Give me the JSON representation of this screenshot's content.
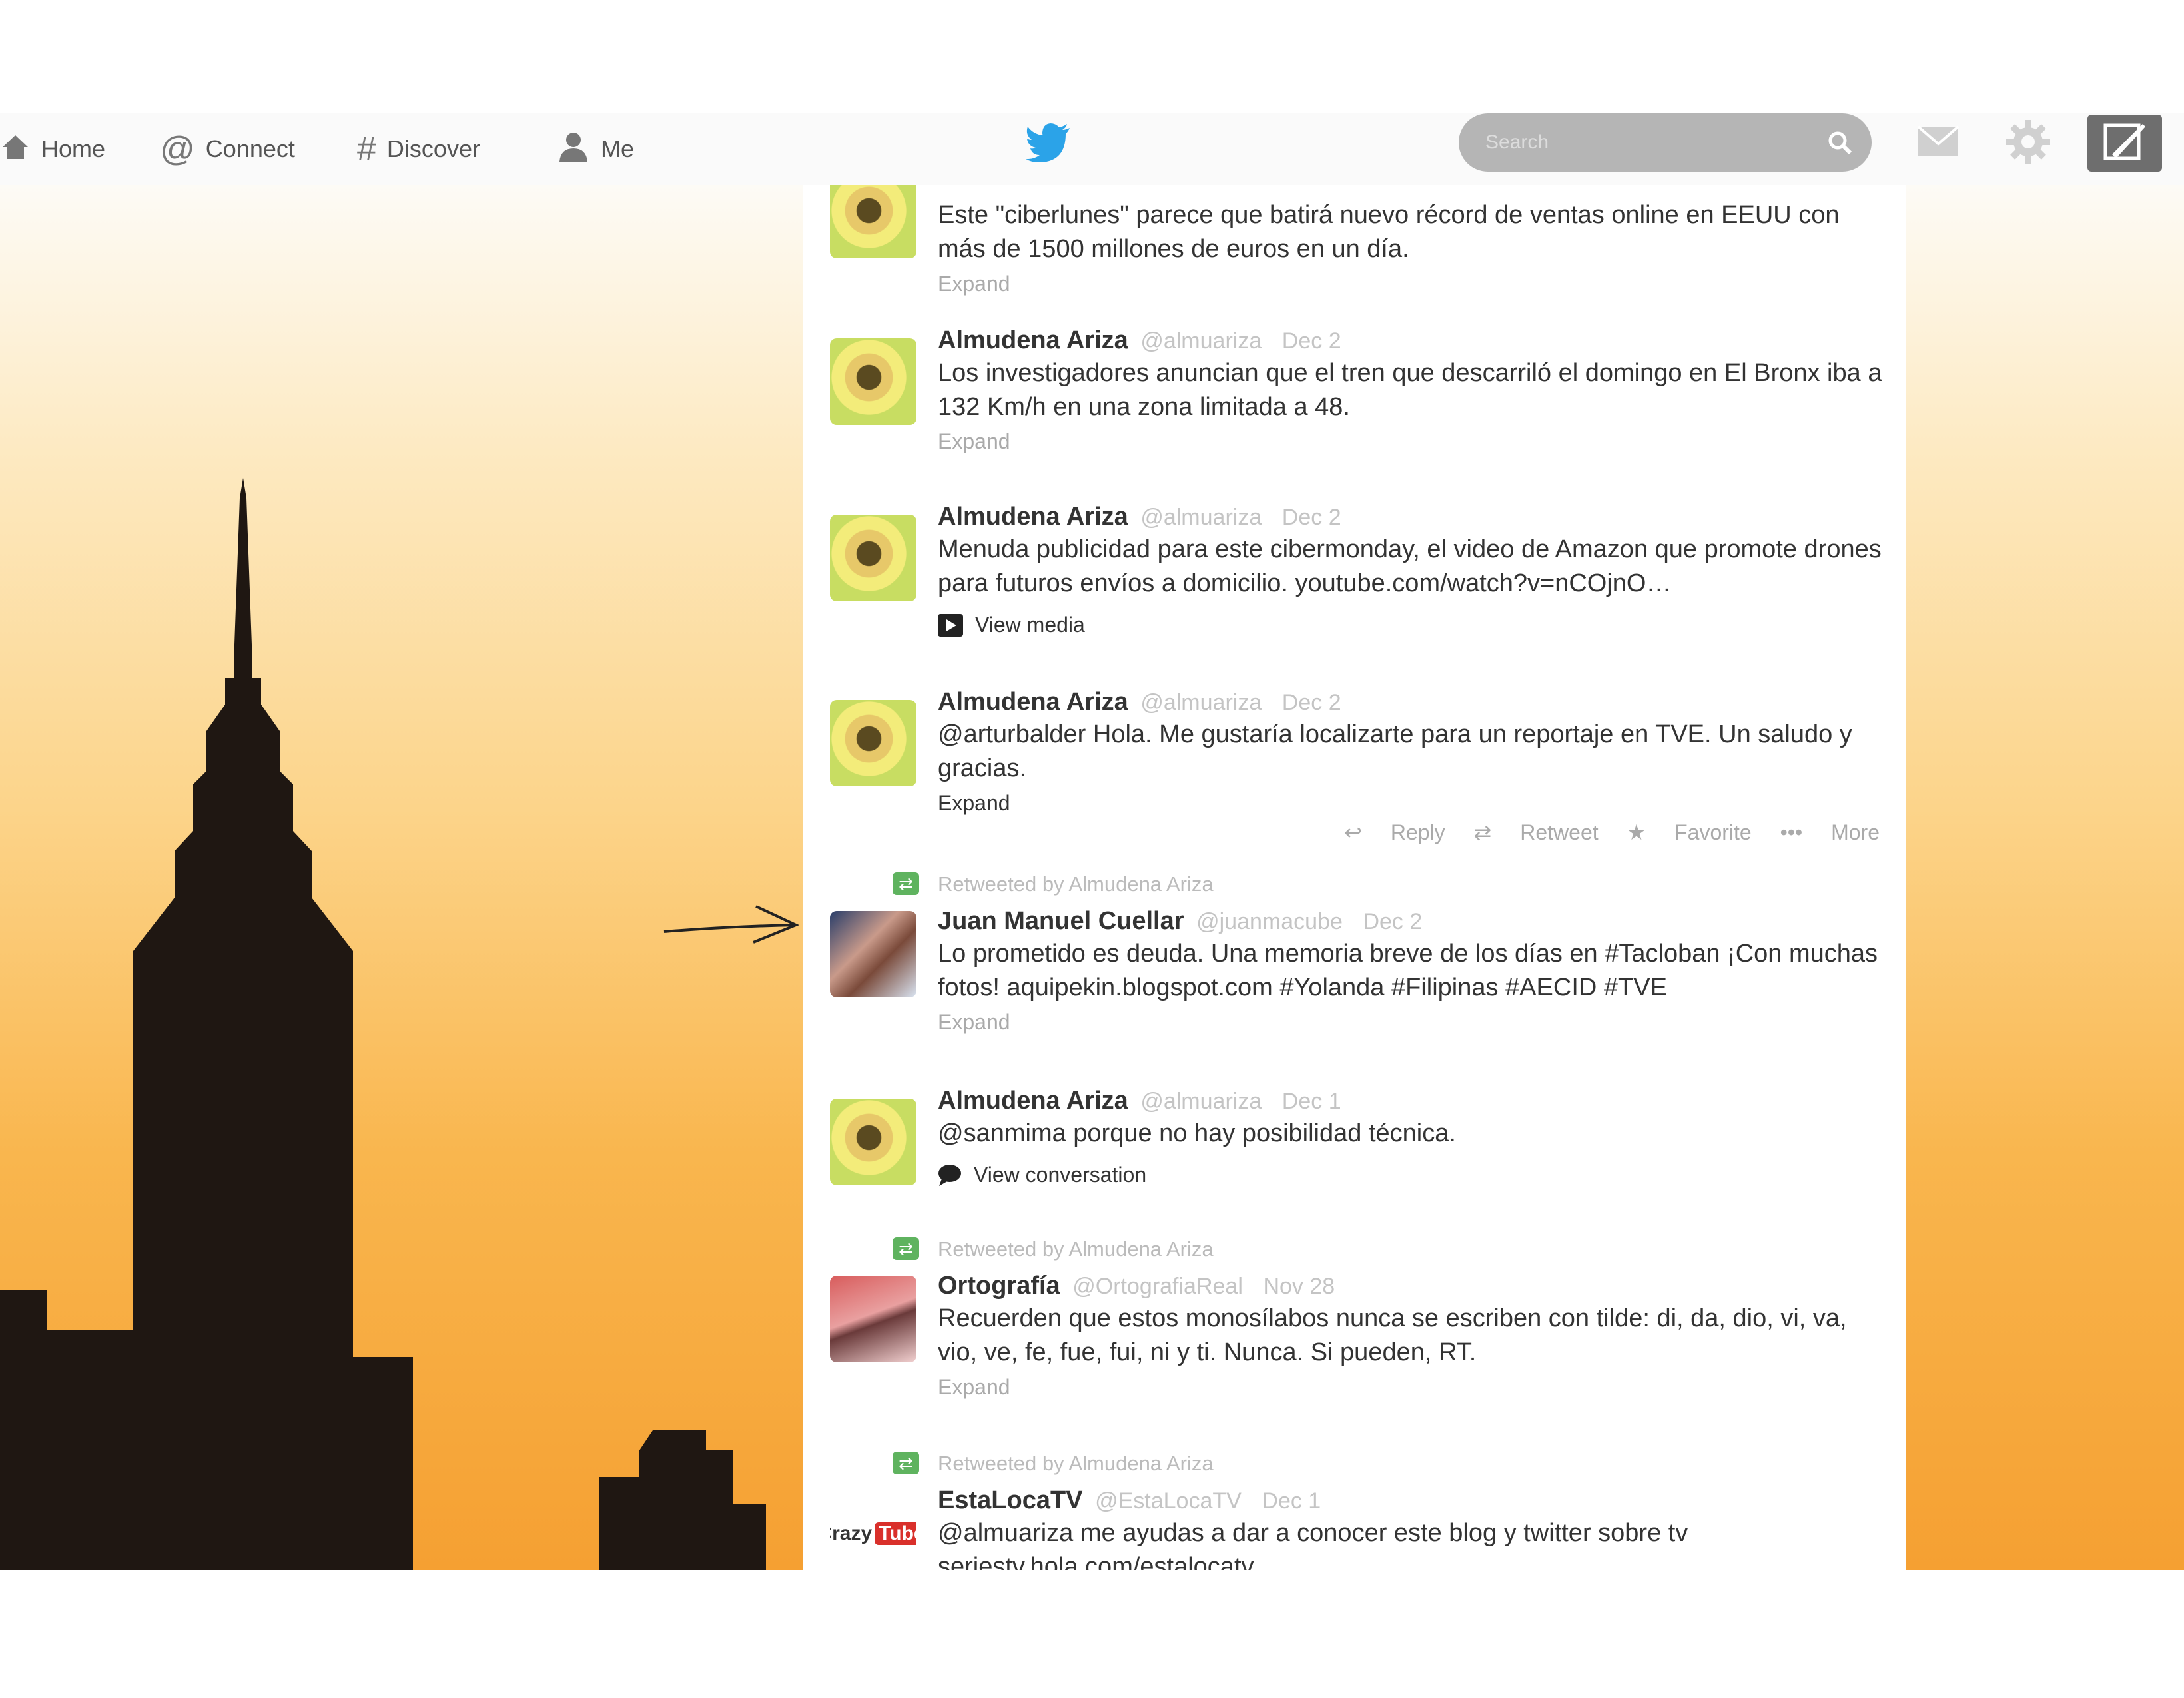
{
  "nav": {
    "home": "Home",
    "connect": "Connect",
    "discover": "Discover",
    "me": "Me"
  },
  "search": {
    "placeholder": "Search"
  },
  "icons": {
    "home": "home-icon",
    "connect": "at-sign-icon",
    "discover": "hashtag-icon",
    "me": "person-icon",
    "logo": "twitter-bird-icon",
    "search": "magnifier-icon",
    "messages": "envelope-icon",
    "settings": "gear-icon",
    "compose": "compose-quill-icon"
  },
  "colors": {
    "twitter_blue": "#2ba3e8",
    "retweet_green": "#5fb35f",
    "background_top": "#fdfbf6",
    "background_bottom": "#f5a032"
  },
  "tweets": [
    {
      "name": "",
      "handle": "",
      "time": "",
      "text": "Este \"ciberlunes\" parece que batirá nuevo récord de ventas online en EEUU con más de 1500 millones de euros en un día.",
      "footer": "Expand"
    },
    {
      "name": "Almudena Ariza",
      "handle": "@almuariza",
      "time": "Dec 2",
      "text": "Los investigadores anuncian que el tren que descarriló el domingo en El Bronx iba a 132 Km/h en una zona limitada a 48.",
      "footer": "Expand"
    },
    {
      "name": "Almudena Ariza",
      "handle": "@almuariza",
      "time": "Dec 2",
      "text": "Menuda publicidad para este cibermonday, el video de Amazon que promote drones para futuros envíos a domicilio. youtube.com/watch?v=nCOjnO…",
      "footer": "View media"
    },
    {
      "name": "Almudena Ariza",
      "handle": "@almuariza",
      "time": "Dec 2",
      "text": "@arturbalder Hola. Me gustaría localizarte para un reportaje en TVE. Un saludo y gracias.",
      "footer": "Expand",
      "actions": {
        "reply": "Reply",
        "retweet": "Retweet",
        "favorite": "Favorite",
        "more": "More"
      }
    },
    {
      "retweeted_by": "Retweeted by Almudena Ariza",
      "name": "Juan Manuel Cuellar",
      "handle": "@juanmacube",
      "time": "Dec 2",
      "text": "Lo prometido es deuda. Una memoria breve de los días en #Tacloban ¡Con muchas fotos! aquipekin.blogspot.com #Yolanda #Filipinas #AECID #TVE",
      "footer": "Expand"
    },
    {
      "name": "Almudena Ariza",
      "handle": "@almuariza",
      "time": "Dec 1",
      "text": "@sanmima porque no hay posibilidad técnica.",
      "footer": "View conversation"
    },
    {
      "retweeted_by": "Retweeted by Almudena Ariza",
      "name": "Ortografía",
      "handle": "@OrtografiaReal",
      "time": "Nov 28",
      "text": "Recuerden que estos monosílabos nunca se escriben con tilde: di, da, dio, vi, va, vio, ve, fe, fue, fui, ni y ti. Nunca. Si pueden, RT.",
      "footer": "Expand"
    },
    {
      "retweeted_by": "Retweeted by Almudena Ariza",
      "name": "EstaLocaTV",
      "handle": "@EstaLocaTV",
      "time": "Dec 1",
      "text": "@almuariza me ayudas a dar a conocer este blog y twitter sobre tv seriestv.hola.com/estalocatv",
      "avatar_label": "Crazy",
      "avatar_badge": "Tube"
    }
  ]
}
